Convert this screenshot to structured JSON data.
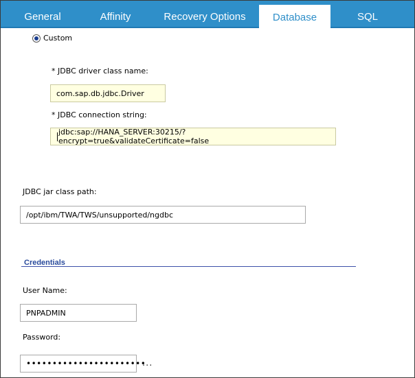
{
  "tabs": [
    {
      "label": "General"
    },
    {
      "label": "Affinity"
    },
    {
      "label": "Recovery Options"
    },
    {
      "label": "Database"
    },
    {
      "label": "SQL"
    }
  ],
  "active_tab": "Database",
  "custom_radio": {
    "label": "Custom",
    "selected": true
  },
  "jdbc_driver": {
    "label": "*  JDBC driver class name:",
    "value": "com.sap.db.jdbc.Driver"
  },
  "jdbc_conn": {
    "label": "*  JDBC connection string:",
    "value": "jdbc:sap://HANA_SERVER:30215/?encrypt=true&validateCertificate=false"
  },
  "jar_path": {
    "label": "JDBC jar class path:",
    "value": "/opt/ibm/TWA/TWS/unsupported/ngdbc"
  },
  "credentials": {
    "title": "Credentials",
    "username_label": "User Name:",
    "username_value": "PNPADMIN",
    "password_label": "Password:",
    "password_value": "•••••••••••••••••••••••",
    "more_label": "..."
  },
  "colors": {
    "tabbar": "#2f8fc9",
    "field_highlight": "#ffffe1",
    "section_title": "#2a4b9c"
  }
}
